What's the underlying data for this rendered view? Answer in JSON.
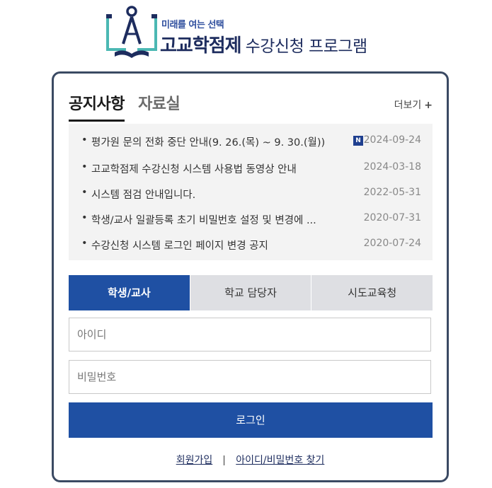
{
  "header": {
    "tagline": "미래를 여는 선택",
    "title_strong": "고교학점제",
    "title_sub": "수강신청 프로그램"
  },
  "board": {
    "tabs": [
      {
        "label": "공지사항",
        "active": true
      },
      {
        "label": "자료실",
        "active": false
      }
    ],
    "more_label": "더보기",
    "more_plus": "+",
    "new_badge": "N",
    "items": [
      {
        "bullet": "•",
        "title": "평가원 문의 전화 중단 안내(9. 26.(목) ~ 9. 30.(월))",
        "date": "2024-09-24",
        "is_new": true
      },
      {
        "bullet": "•",
        "title": "고교학점제 수강신청 시스템 사용법 동영상 안내",
        "date": "2024-03-18",
        "is_new": false
      },
      {
        "bullet": "•",
        "title": "시스템 점검 안내입니다.",
        "date": "2022-05-31",
        "is_new": false
      },
      {
        "bullet": "•",
        "title": "학생/교사 일괄등록 초기 비밀번호 설정 및 변경에 ...",
        "date": "2020-07-31",
        "is_new": false
      },
      {
        "bullet": "•",
        "title": "수강신청 시스템 로그인 페이지 변경 공지",
        "date": "2020-07-24",
        "is_new": false
      }
    ]
  },
  "login": {
    "role_tabs": [
      {
        "label": "학생/교사",
        "active": true
      },
      {
        "label": "학교 담당자",
        "active": false
      },
      {
        "label": "시도교육청",
        "active": false
      }
    ],
    "id_placeholder": "아이디",
    "pw_placeholder": "비밀번호",
    "submit_label": "로그인",
    "signup_link": "회원가입",
    "find_link": "아이디/비밀번호 찾기"
  },
  "colors": {
    "primary": "#1f50a3",
    "logo_teal": "#4bb8b3",
    "logo_navy": "#1d2c5e",
    "border": "#3b4a63"
  }
}
